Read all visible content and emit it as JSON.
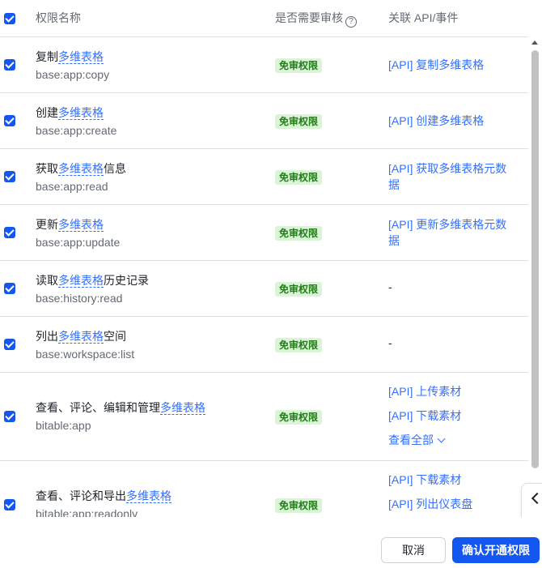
{
  "header": {
    "col_name": "权限名称",
    "col_review": "是否需要审核",
    "col_review_help_icon": "question-circle-icon",
    "col_api": "关联 API/事件"
  },
  "rows": [
    {
      "title_prefix": "复制",
      "title_link": "多维表格",
      "title_suffix": "",
      "scope": "base:app:copy",
      "badge": "免审权限",
      "api": [
        "[API] 复制多维表格"
      ]
    },
    {
      "title_prefix": "创建",
      "title_link": "多维表格",
      "title_suffix": "",
      "scope": "base:app:create",
      "badge": "免审权限",
      "api": [
        "[API] 创建多维表格"
      ]
    },
    {
      "title_prefix": "获取",
      "title_link": "多维表格",
      "title_suffix": "信息",
      "scope": "base:app:read",
      "badge": "免审权限",
      "api": [
        "[API] 获取多维表格元数据"
      ]
    },
    {
      "title_prefix": "更新",
      "title_link": "多维表格",
      "title_suffix": "",
      "scope": "base:app:update",
      "badge": "免审权限",
      "api": [
        "[API] 更新多维表格元数据"
      ]
    },
    {
      "title_prefix": "读取",
      "title_link": "多维表格",
      "title_suffix": "历史记录",
      "scope": "base:history:read",
      "badge": "免审权限",
      "api_none": "-"
    },
    {
      "title_prefix": "列出",
      "title_link": "多维表格",
      "title_suffix": "空间",
      "scope": "base:workspace:list",
      "badge": "免审权限",
      "api_none": "-"
    },
    {
      "title_prefix": "查看、评论、编辑和管理",
      "title_link": "多维表格",
      "title_suffix": "",
      "scope": "bitable:app",
      "badge": "免审权限",
      "api": [
        "[API] 上传素材",
        "[API] 下载素材"
      ],
      "more": "查看全部"
    },
    {
      "title_prefix": "查看、评论和导出",
      "title_link": "多维表格",
      "title_suffix": "",
      "scope": "bitable:app:readonly",
      "badge": "免审权限",
      "api": [
        "[API] 下载素材",
        "[API] 列出仪表盘"
      ]
    }
  ],
  "float_button": {
    "label": "展开",
    "icon": "chevron-left-icon"
  },
  "footer": {
    "cancel_label": "取消",
    "confirm_label": "确认开通权限"
  },
  "colors": {
    "primary": "#1456f0",
    "link": "#3370ff",
    "badge_bg": "#d9f5d6",
    "badge_text": "#237b19"
  }
}
